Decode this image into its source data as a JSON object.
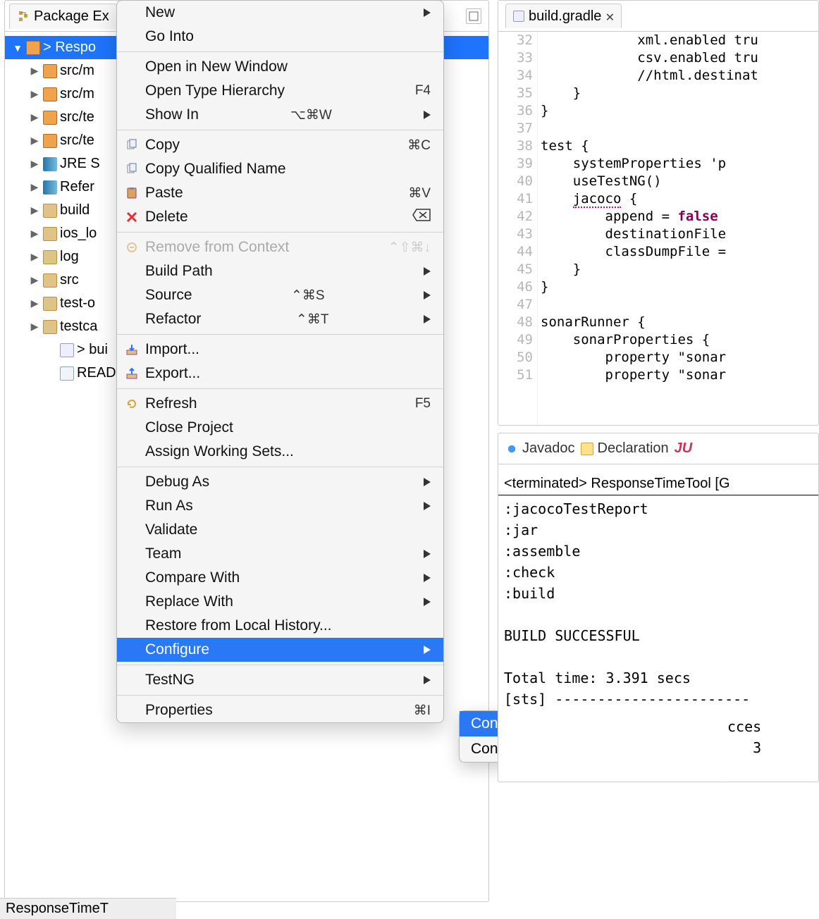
{
  "pkg": {
    "tab_label": "Package Ex",
    "selected": "> Respo",
    "items": [
      {
        "toggle": "▶",
        "icon": "pkg",
        "label": "src/m"
      },
      {
        "toggle": "▶",
        "icon": "pkg",
        "label": "src/m"
      },
      {
        "toggle": "▶",
        "icon": "pkg",
        "label": "src/te"
      },
      {
        "toggle": "▶",
        "icon": "pkg",
        "label": "src/te"
      },
      {
        "toggle": "▶",
        "icon": "lib",
        "label": "JRE S"
      },
      {
        "toggle": "▶",
        "icon": "lib",
        "label": "Refer"
      },
      {
        "toggle": "▶",
        "icon": "folder",
        "label": "build"
      },
      {
        "toggle": "▶",
        "icon": "folder",
        "label": "ios_lo"
      },
      {
        "toggle": "▶",
        "icon": "folder",
        "label": "log"
      },
      {
        "toggle": "▶",
        "icon": "folder",
        "label": "src"
      },
      {
        "toggle": "▶",
        "icon": "folder",
        "label": "test-o"
      },
      {
        "toggle": "▶",
        "icon": "folder",
        "label": "testca"
      },
      {
        "toggle": "",
        "icon": "file",
        "label": "> bui"
      },
      {
        "toggle": "",
        "icon": "doc",
        "label": "READ"
      }
    ]
  },
  "context_groups": [
    [
      {
        "label": "New",
        "arrow": true
      },
      {
        "label": "Go Into"
      }
    ],
    [
      {
        "label": "Open in New Window"
      },
      {
        "label": "Open Type Hierarchy",
        "shortcut": "F4"
      },
      {
        "label": "Show In",
        "shortcut": "⌥⌘W",
        "arrow": true
      }
    ],
    [
      {
        "label": "Copy",
        "icon": "copy",
        "shortcut": "⌘C"
      },
      {
        "label": "Copy Qualified Name",
        "icon": "copy"
      },
      {
        "label": "Paste",
        "icon": "paste",
        "shortcut": "⌘V"
      },
      {
        "label": "Delete",
        "icon": "delete",
        "shortcut_icon": "del"
      }
    ],
    [
      {
        "label": "Remove from Context",
        "icon": "remove",
        "shortcut": "⌃⇧⌘↓",
        "disabled": true
      },
      {
        "label": "Build Path",
        "arrow": true
      },
      {
        "label": "Source",
        "shortcut": "⌃⌘S",
        "arrow": true
      },
      {
        "label": "Refactor",
        "shortcut": "⌃⌘T",
        "arrow": true
      }
    ],
    [
      {
        "label": "Import...",
        "icon": "import"
      },
      {
        "label": "Export...",
        "icon": "export"
      }
    ],
    [
      {
        "label": "Refresh",
        "icon": "refresh",
        "shortcut": "F5"
      },
      {
        "label": "Close Project"
      },
      {
        "label": "Assign Working Sets..."
      }
    ],
    [
      {
        "label": "Debug As",
        "arrow": true
      },
      {
        "label": "Run As",
        "arrow": true
      },
      {
        "label": "Validate"
      },
      {
        "label": "Team",
        "arrow": true
      },
      {
        "label": "Compare With",
        "arrow": true
      },
      {
        "label": "Replace With",
        "arrow": true
      },
      {
        "label": "Restore from Local History..."
      },
      {
        "label": "Configure",
        "arrow": true,
        "selected": true
      }
    ],
    [
      {
        "label": "TestNG",
        "arrow": true
      }
    ],
    [
      {
        "label": "Properties",
        "shortcut": "⌘I"
      }
    ]
  ],
  "submenu": [
    {
      "label": "Convert to Gradle Project",
      "selected": true
    },
    {
      "label": "Convert to Maven Project"
    }
  ],
  "editor": {
    "tab": "build.gradle",
    "first_line": 32,
    "code_lines": [
      "            xml.enabled tru",
      "            csv.enabled tru",
      "            //html.destinat",
      "    }",
      "}",
      "",
      "test {",
      "    systemProperties 'p",
      "    useTestNG()",
      "    jacoco {",
      "        append = false",
      "        destinationFile",
      "        classDumpFile =",
      "    }",
      "}",
      "",
      "sonarRunner {",
      "    sonarProperties {",
      "        property \"sonar",
      "        property \"sonar"
    ]
  },
  "bottom": {
    "tabs": {
      "javadoc": "Javadoc",
      "decl": "Declaration",
      "junit": "JU"
    },
    "header": "<terminated> ResponseTimeTool [G",
    "console_lines": [
      ":jacocoTestReport",
      ":jar",
      ":assemble",
      ":check",
      ":build",
      "",
      "BUILD SUCCESSFUL",
      "",
      "Total time: 3.391 secs",
      "[sts] -----------------------"
    ],
    "extra_tail": [
      "cces",
      "   3"
    ]
  },
  "status": "ResponseTimeT"
}
